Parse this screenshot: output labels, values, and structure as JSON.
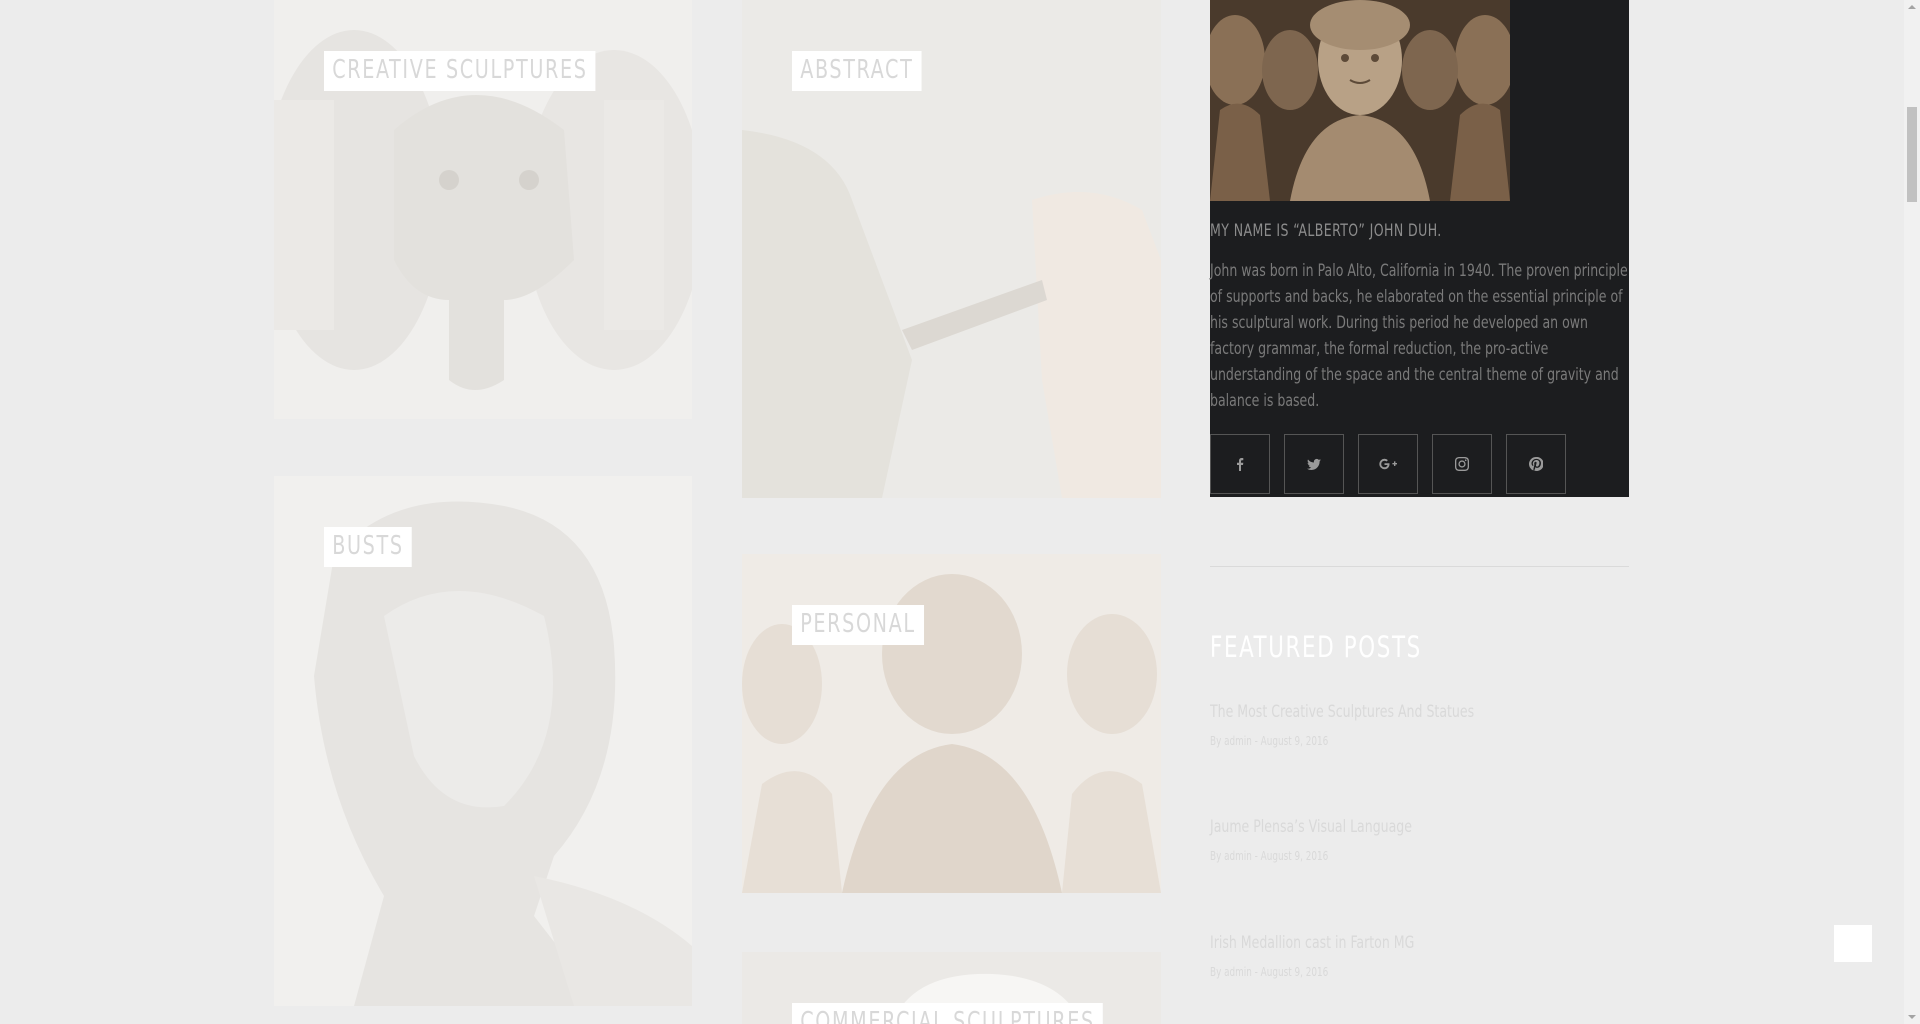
{
  "categories": [
    {
      "label": "CREATIVE SCULPTURES",
      "image": "elephant-sculpture"
    },
    {
      "label": "ABSTRACT",
      "image": "hand-carving-stone"
    },
    {
      "label": "BUSTS",
      "image": "classical-bust"
    },
    {
      "label": "PERSONAL",
      "image": "terracotta-figurines"
    },
    {
      "label": "COMMERCIAL SCULPTURES",
      "image": "white-sculpture"
    }
  ],
  "about": {
    "image": "terracotta-figurines",
    "name": "MY NAME IS “ALBERTO” JOHN DUH.",
    "bio": "John was born in Palo Alto, California in 1940. The proven principle of supports and backs, he elaborated on the essential principle of his sculptural work. During this period he developed an own factory grammar, the formal reduction, the pro-active understanding of the space and the central theme of gravity and balance is based.",
    "socials": [
      {
        "name": "facebook",
        "glyph": "f"
      },
      {
        "name": "twitter",
        "glyph": "t"
      },
      {
        "name": "google-plus",
        "glyph": "G+"
      },
      {
        "name": "instagram",
        "glyph": "ig"
      },
      {
        "name": "pinterest",
        "glyph": "p"
      }
    ]
  },
  "featured": {
    "title": "FEATURED POSTS",
    "posts": [
      {
        "title": "The Most Creative Sculptures And Statues",
        "meta": "By admin - August 9, 2016"
      },
      {
        "title": "Jaume Plensa’s Visual Language",
        "meta": "By admin - August 9, 2016"
      },
      {
        "title": "Irish Medallion cast in Farton MG",
        "meta": "By admin - August 9, 2016"
      }
    ]
  },
  "colors": {
    "page_bg": "#ececec",
    "about_bg": "#1c1d1f",
    "label_bg": "#ffffff",
    "label_text": "#d8d8d8"
  }
}
